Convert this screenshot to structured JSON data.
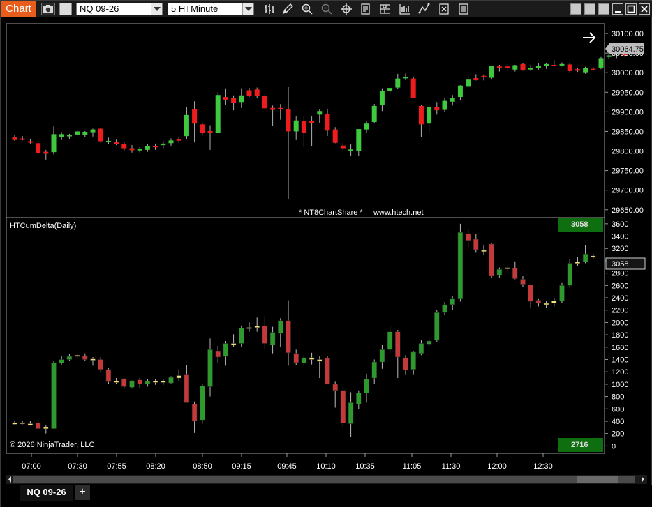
{
  "app": {
    "tag": "Chart"
  },
  "toolbar": {
    "instrument": "NQ 09-26",
    "interval": "5 HTMinute",
    "tools": [
      "bars-icon",
      "pencil-icon",
      "zoom-in-icon",
      "zoom-out-icon",
      "crosshair-icon",
      "properties-icon",
      "data-box-icon",
      "chart-style-icon",
      "drawing-tools-icon",
      "strategies-icon",
      "indicators-icon"
    ]
  },
  "price_panel": {
    "watermark": "* NT8ChartShare *     www.htech.net",
    "last_price": "30064.75",
    "y_ticks": [
      "30100.00",
      "30050.00",
      "30000.00",
      "29950.00",
      "29900.00",
      "29850.00",
      "29800.00",
      "29750.00",
      "29700.00",
      "29650.00"
    ],
    "colors": {
      "up": "#3fc93f",
      "down": "#ee1c1c",
      "wick": "#b0b0b0"
    }
  },
  "indicator_panel": {
    "title": "HTCumDelta(Daily)",
    "copyright": "© 2026 NinjaTrader, LLC",
    "top_badge": "3058",
    "bottom_badge": "2716",
    "last_value": "3058",
    "y_ticks": [
      "3600",
      "3400",
      "3200",
      "3000",
      "2800",
      "2600",
      "2400",
      "2200",
      "2000",
      "1800",
      "1600",
      "1400",
      "1200",
      "1000",
      "800",
      "600",
      "400",
      "200",
      "0"
    ]
  },
  "x_axis": {
    "labels": [
      "07:00",
      "07:30",
      "07:55",
      "08:20",
      "08:50",
      "09:15",
      "09:45",
      "10:10",
      "10:35",
      "11:05",
      "11:30",
      "12:00",
      "12:30"
    ]
  },
  "tabs": {
    "active": "NQ 09-26",
    "add": "+"
  },
  "chart_data": [
    {
      "type": "candlestick",
      "title": "",
      "ylim": [
        29630,
        30125
      ],
      "series": [
        {
          "o": 29835,
          "h": 29840,
          "l": 29826,
          "c": 29828
        },
        {
          "o": 29832,
          "h": 29838,
          "l": 29827,
          "c": 29830
        },
        {
          "o": 29825,
          "h": 29830,
          "l": 29819,
          "c": 29823
        },
        {
          "o": 29820,
          "h": 29826,
          "l": 29793,
          "c": 29795
        },
        {
          "o": 29798,
          "h": 29803,
          "l": 29778,
          "c": 29793
        },
        {
          "o": 29797,
          "h": 29863,
          "l": 29791,
          "c": 29843
        },
        {
          "o": 29836,
          "h": 29848,
          "l": 29828,
          "c": 29843
        },
        {
          "o": 29838,
          "h": 29844,
          "l": 29830,
          "c": 29841
        },
        {
          "o": 29842,
          "h": 29853,
          "l": 29838,
          "c": 29850
        },
        {
          "o": 29841,
          "h": 29851,
          "l": 29835,
          "c": 29849
        },
        {
          "o": 29848,
          "h": 29857,
          "l": 29837,
          "c": 29855
        },
        {
          "o": 29857,
          "h": 29860,
          "l": 29821,
          "c": 29825
        },
        {
          "o": 29824,
          "h": 29834,
          "l": 29818,
          "c": 29826
        },
        {
          "o": 29823,
          "h": 29829,
          "l": 29815,
          "c": 29818
        },
        {
          "o": 29818,
          "h": 29822,
          "l": 29800,
          "c": 29807
        },
        {
          "o": 29807,
          "h": 29815,
          "l": 29796,
          "c": 29802
        },
        {
          "o": 29802,
          "h": 29810,
          "l": 29796,
          "c": 29805
        },
        {
          "o": 29803,
          "h": 29817,
          "l": 29798,
          "c": 29812
        },
        {
          "o": 29813,
          "h": 29819,
          "l": 29803,
          "c": 29810
        },
        {
          "o": 29815,
          "h": 29825,
          "l": 29807,
          "c": 29819
        },
        {
          "o": 29820,
          "h": 29832,
          "l": 29813,
          "c": 29827
        },
        {
          "o": 29830,
          "h": 29837,
          "l": 29821,
          "c": 29829
        },
        {
          "o": 29838,
          "h": 29912,
          "l": 29830,
          "c": 29892
        },
        {
          "o": 29906,
          "h": 29927,
          "l": 29822,
          "c": 29870
        },
        {
          "o": 29868,
          "h": 29872,
          "l": 29840,
          "c": 29846
        },
        {
          "o": 29851,
          "h": 29866,
          "l": 29803,
          "c": 29846
        },
        {
          "o": 29847,
          "h": 29950,
          "l": 29845,
          "c": 29943
        },
        {
          "o": 29938,
          "h": 29960,
          "l": 29918,
          "c": 29931
        },
        {
          "o": 29935,
          "h": 29942,
          "l": 29904,
          "c": 29923
        },
        {
          "o": 29925,
          "h": 29960,
          "l": 29910,
          "c": 29942
        },
        {
          "o": 29955,
          "h": 29961,
          "l": 29938,
          "c": 29941
        },
        {
          "o": 29957,
          "h": 29962,
          "l": 29936,
          "c": 29941
        },
        {
          "o": 29941,
          "h": 29945,
          "l": 29908,
          "c": 29909
        },
        {
          "o": 29910,
          "h": 29916,
          "l": 29865,
          "c": 29905
        },
        {
          "o": 29910,
          "h": 29920,
          "l": 29880,
          "c": 29908
        },
        {
          "o": 29906,
          "h": 29963,
          "l": 29678,
          "c": 29850
        },
        {
          "o": 29850,
          "h": 29888,
          "l": 29828,
          "c": 29878
        },
        {
          "o": 29877,
          "h": 29888,
          "l": 29810,
          "c": 29847
        },
        {
          "o": 29877,
          "h": 29888,
          "l": 29812,
          "c": 29872
        },
        {
          "o": 29893,
          "h": 29906,
          "l": 29871,
          "c": 29902
        },
        {
          "o": 29895,
          "h": 29906,
          "l": 29838,
          "c": 29852
        },
        {
          "o": 29855,
          "h": 29861,
          "l": 29820,
          "c": 29821
        },
        {
          "o": 29814,
          "h": 29824,
          "l": 29800,
          "c": 29807
        },
        {
          "o": 29804,
          "h": 29817,
          "l": 29787,
          "c": 29804
        },
        {
          "o": 29800,
          "h": 29843,
          "l": 29788,
          "c": 29856
        },
        {
          "o": 29855,
          "h": 29876,
          "l": 29846,
          "c": 29870
        },
        {
          "o": 29874,
          "h": 29920,
          "l": 29872,
          "c": 29915
        },
        {
          "o": 29917,
          "h": 29960,
          "l": 29902,
          "c": 29953
        },
        {
          "o": 29953,
          "h": 29964,
          "l": 29945,
          "c": 29961
        },
        {
          "o": 29962,
          "h": 29997,
          "l": 29958,
          "c": 29985
        },
        {
          "o": 29988,
          "h": 29998,
          "l": 29982,
          "c": 29989
        },
        {
          "o": 29985,
          "h": 29990,
          "l": 29935,
          "c": 29936
        },
        {
          "o": 29915,
          "h": 29918,
          "l": 29836,
          "c": 29868
        },
        {
          "o": 29870,
          "h": 29918,
          "l": 29848,
          "c": 29913
        },
        {
          "o": 29912,
          "h": 29925,
          "l": 29893,
          "c": 29904
        },
        {
          "o": 29905,
          "h": 29935,
          "l": 29900,
          "c": 29928
        },
        {
          "o": 29926,
          "h": 29943,
          "l": 29916,
          "c": 29935
        },
        {
          "o": 29938,
          "h": 29968,
          "l": 29929,
          "c": 29967
        },
        {
          "o": 29964,
          "h": 29993,
          "l": 29962,
          "c": 29984
        },
        {
          "o": 29986,
          "h": 29996,
          "l": 29980,
          "c": 29983
        },
        {
          "o": 29992,
          "h": 29996,
          "l": 29980,
          "c": 29988
        },
        {
          "o": 29987,
          "h": 30018,
          "l": 29984,
          "c": 30017
        },
        {
          "o": 30016,
          "h": 30020,
          "l": 30003,
          "c": 30012
        },
        {
          "o": 30016,
          "h": 30022,
          "l": 30004,
          "c": 30015
        },
        {
          "o": 30008,
          "h": 30020,
          "l": 30003,
          "c": 30019
        },
        {
          "o": 30022,
          "h": 30025,
          "l": 30005,
          "c": 30006
        },
        {
          "o": 30008,
          "h": 30020,
          "l": 30004,
          "c": 30012
        },
        {
          "o": 30012,
          "h": 30024,
          "l": 30008,
          "c": 30018
        },
        {
          "o": 30017,
          "h": 30025,
          "l": 30010,
          "c": 30022
        },
        {
          "o": 30020,
          "h": 30032,
          "l": 30017,
          "c": 30019
        },
        {
          "o": 30021,
          "h": 30026,
          "l": 30016,
          "c": 30022
        },
        {
          "o": 30021,
          "h": 30025,
          "l": 30001,
          "c": 30004
        },
        {
          "o": 30009,
          "h": 30013,
          "l": 30002,
          "c": 30005
        },
        {
          "o": 30001,
          "h": 30015,
          "l": 29997,
          "c": 30012
        },
        {
          "o": 30010,
          "h": 30014,
          "l": 30006,
          "c": 30009
        },
        {
          "o": 30013,
          "h": 30040,
          "l": 30009,
          "c": 30037
        },
        {
          "o": 30040,
          "h": 30052,
          "l": 30035,
          "c": 30044
        },
        {
          "o": 30049,
          "h": 30058,
          "l": 30037,
          "c": 30053
        },
        {
          "o": 30053,
          "h": 30062,
          "l": 30041,
          "c": 30044
        },
        {
          "o": 30050,
          "h": 30073,
          "l": 30044,
          "c": 30063
        },
        {
          "o": 30064,
          "h": 30069,
          "l": 30061,
          "c": 30065
        }
      ]
    },
    {
      "type": "candlestick",
      "title": "HTCumDelta(Daily)",
      "ylim": [
        -120,
        3700
      ],
      "series": [
        {
          "o": 380,
          "h": 410,
          "l": 340,
          "c": 350
        },
        {
          "o": 380,
          "h": 410,
          "l": 350,
          "c": 370
        },
        {
          "o": 360,
          "h": 400,
          "l": 330,
          "c": 340
        },
        {
          "o": 370,
          "h": 420,
          "l": 300,
          "c": 280
        },
        {
          "o": 280,
          "h": 340,
          "l": 200,
          "c": 300
        },
        {
          "o": 280,
          "h": 1380,
          "l": 280,
          "c": 1350
        },
        {
          "o": 1340,
          "h": 1450,
          "l": 1320,
          "c": 1400
        },
        {
          "o": 1400,
          "h": 1490,
          "l": 1380,
          "c": 1450
        },
        {
          "o": 1460,
          "h": 1500,
          "l": 1420,
          "c": 1470
        },
        {
          "o": 1460,
          "h": 1500,
          "l": 1380,
          "c": 1400
        },
        {
          "o": 1410,
          "h": 1440,
          "l": 1300,
          "c": 1400
        },
        {
          "o": 1400,
          "h": 1440,
          "l": 1200,
          "c": 1240
        },
        {
          "o": 1240,
          "h": 1260,
          "l": 1000,
          "c": 1040
        },
        {
          "o": 1040,
          "h": 1100,
          "l": 1000,
          "c": 1050
        },
        {
          "o": 1090,
          "h": 1100,
          "l": 940,
          "c": 960
        },
        {
          "o": 950,
          "h": 1060,
          "l": 930,
          "c": 1050
        },
        {
          "o": 1070,
          "h": 1100,
          "l": 940,
          "c": 1000
        },
        {
          "o": 1000,
          "h": 1080,
          "l": 960,
          "c": 1050
        },
        {
          "o": 1050,
          "h": 1080,
          "l": 990,
          "c": 1040
        },
        {
          "o": 1040,
          "h": 1080,
          "l": 990,
          "c": 1050
        },
        {
          "o": 1020,
          "h": 1130,
          "l": 1000,
          "c": 1110
        },
        {
          "o": 1100,
          "h": 1240,
          "l": 1050,
          "c": 1140
        },
        {
          "o": 1150,
          "h": 1310,
          "l": 1100,
          "c": 700
        },
        {
          "o": 680,
          "h": 720,
          "l": 210,
          "c": 400
        },
        {
          "o": 420,
          "h": 1010,
          "l": 360,
          "c": 970
        },
        {
          "o": 960,
          "h": 1740,
          "l": 800,
          "c": 1560
        },
        {
          "o": 1530,
          "h": 1620,
          "l": 1350,
          "c": 1440
        },
        {
          "o": 1450,
          "h": 1700,
          "l": 1300,
          "c": 1660
        },
        {
          "o": 1640,
          "h": 1810,
          "l": 1600,
          "c": 1660
        },
        {
          "o": 1660,
          "h": 1950,
          "l": 1600,
          "c": 1910
        },
        {
          "o": 1900,
          "h": 2000,
          "l": 1850,
          "c": 1920
        },
        {
          "o": 1940,
          "h": 2080,
          "l": 1850,
          "c": 1940
        },
        {
          "o": 1940,
          "h": 2100,
          "l": 1560,
          "c": 1660
        },
        {
          "o": 1640,
          "h": 1930,
          "l": 1500,
          "c": 1840
        },
        {
          "o": 1820,
          "h": 2070,
          "l": 1600,
          "c": 2030
        },
        {
          "o": 2030,
          "h": 2360,
          "l": 1300,
          "c": 1510
        },
        {
          "o": 1500,
          "h": 1560,
          "l": 1310,
          "c": 1350
        },
        {
          "o": 1340,
          "h": 1470,
          "l": 1300,
          "c": 1430
        },
        {
          "o": 1430,
          "h": 1510,
          "l": 1320,
          "c": 1400
        },
        {
          "o": 1400,
          "h": 1450,
          "l": 1100,
          "c": 1370
        },
        {
          "o": 1420,
          "h": 1450,
          "l": 1000,
          "c": 1000
        },
        {
          "o": 1000,
          "h": 1040,
          "l": 620,
          "c": 900
        },
        {
          "o": 900,
          "h": 950,
          "l": 300,
          "c": 370
        },
        {
          "o": 360,
          "h": 870,
          "l": 150,
          "c": 700
        },
        {
          "o": 680,
          "h": 900,
          "l": 600,
          "c": 860
        },
        {
          "o": 860,
          "h": 1170,
          "l": 700,
          "c": 1080
        },
        {
          "o": 1100,
          "h": 1400,
          "l": 1000,
          "c": 1360
        },
        {
          "o": 1360,
          "h": 1640,
          "l": 1250,
          "c": 1560
        },
        {
          "o": 1560,
          "h": 1940,
          "l": 1500,
          "c": 1850
        },
        {
          "o": 1850,
          "h": 1880,
          "l": 1100,
          "c": 1440
        },
        {
          "o": 1430,
          "h": 1470,
          "l": 1150,
          "c": 1230
        },
        {
          "o": 1240,
          "h": 1540,
          "l": 1150,
          "c": 1520
        },
        {
          "o": 1500,
          "h": 1710,
          "l": 1470,
          "c": 1660
        },
        {
          "o": 1650,
          "h": 1750,
          "l": 1600,
          "c": 1700
        },
        {
          "o": 1710,
          "h": 2200,
          "l": 1680,
          "c": 2160
        },
        {
          "o": 2160,
          "h": 2330,
          "l": 2120,
          "c": 2290
        },
        {
          "o": 2290,
          "h": 2420,
          "l": 2200,
          "c": 2380
        },
        {
          "o": 2380,
          "h": 3600,
          "l": 2340,
          "c": 3460
        },
        {
          "o": 3440,
          "h": 3510,
          "l": 3200,
          "c": 3330
        },
        {
          "o": 3350,
          "h": 3440,
          "l": 3130,
          "c": 3180
        },
        {
          "o": 3170,
          "h": 3260,
          "l": 3100,
          "c": 3150
        },
        {
          "o": 3270,
          "h": 3290,
          "l": 2720,
          "c": 2750
        },
        {
          "o": 2760,
          "h": 2890,
          "l": 2730,
          "c": 2860
        },
        {
          "o": 2870,
          "h": 2920,
          "l": 2800,
          "c": 2890
        },
        {
          "o": 2880,
          "h": 2990,
          "l": 2700,
          "c": 2710
        },
        {
          "o": 2700,
          "h": 2750,
          "l": 2580,
          "c": 2620
        },
        {
          "o": 2610,
          "h": 2620,
          "l": 2230,
          "c": 2340
        },
        {
          "o": 2360,
          "h": 2380,
          "l": 2260,
          "c": 2310
        },
        {
          "o": 2310,
          "h": 2350,
          "l": 2240,
          "c": 2300
        },
        {
          "o": 2310,
          "h": 2390,
          "l": 2260,
          "c": 2350
        },
        {
          "o": 2350,
          "h": 2640,
          "l": 2320,
          "c": 2600
        },
        {
          "o": 2600,
          "h": 3020,
          "l": 2580,
          "c": 2960
        },
        {
          "o": 2970,
          "h": 3060,
          "l": 2920,
          "c": 2980
        },
        {
          "o": 2980,
          "h": 3250,
          "l": 2960,
          "c": 3110
        },
        {
          "o": 3080,
          "h": 3110,
          "l": 3040,
          "c": 3058
        }
      ]
    }
  ]
}
